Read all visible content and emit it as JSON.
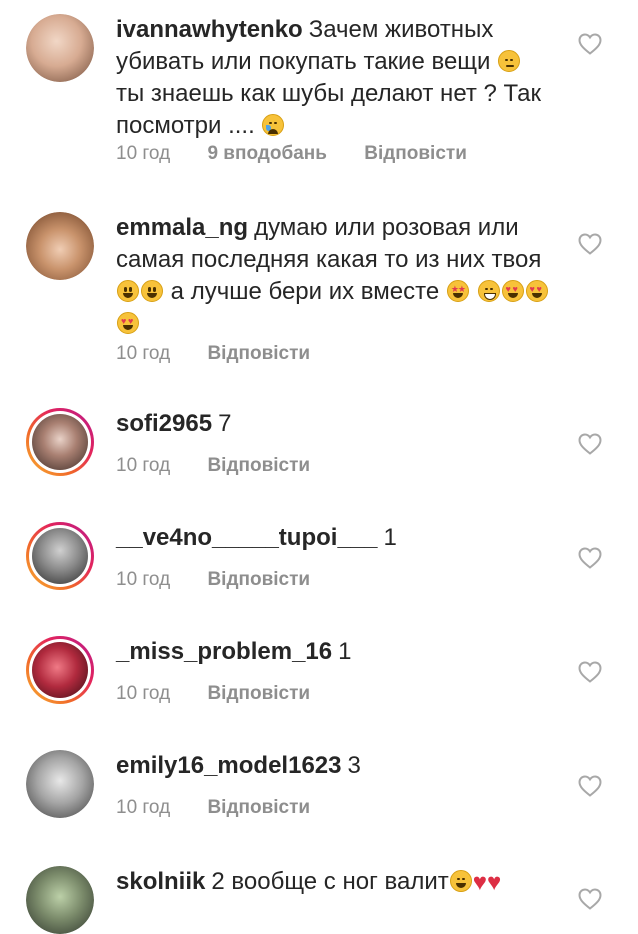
{
  "reply_label": "Відповісти",
  "comments": [
    {
      "username": "ivannawhytenko",
      "text_1": "Зачем животных убивать или покупать такие вещи",
      "emoji_1": "pensive-face",
      "text_2": "ты знаешь как шубы делают нет ? Так посмотри ....",
      "emoji_2": "crying-face",
      "time": "10 год",
      "likes": "9 вподобань",
      "avatar_color": "#d9b8a6"
    },
    {
      "username": "emmala_ng",
      "text_1": "думаю или розовая или самая последняя какая то из них твоя",
      "emoji_1": "smiling-face",
      "text_2": "а лучше бери их вместе",
      "emoji_2": "star-struck",
      "emoji_3": "grinning-face",
      "emoji_4": "heart-eyes",
      "time": "10 год",
      "avatar_color": "#b78f72"
    },
    {
      "username": "sofi2965",
      "text_1": "7",
      "time": "10 год",
      "avatar_color": "#6b5a52"
    },
    {
      "username": "__ve4no_____tupoi___",
      "text_1": "1",
      "time": "10 год",
      "avatar_color": "#6d6d6d"
    },
    {
      "username": "_miss_problem_16",
      "text_1": "1",
      "time": "10 год",
      "avatar_color": "#9a2a3a"
    },
    {
      "username": "emily16_model1623",
      "text_1": "3",
      "time": "10 год",
      "avatar_color": "#9a9a9a"
    },
    {
      "username": "skolniik",
      "text_1": "2 вообще с ног валит",
      "emoji_1": "laughing-face",
      "emoji_2": "red-heart",
      "time": "",
      "avatar_color": "#7a8a6a"
    }
  ],
  "colors": {
    "text": "#262626",
    "meta": "#8e8e8e",
    "heart_outline": "#a8a8a8"
  }
}
